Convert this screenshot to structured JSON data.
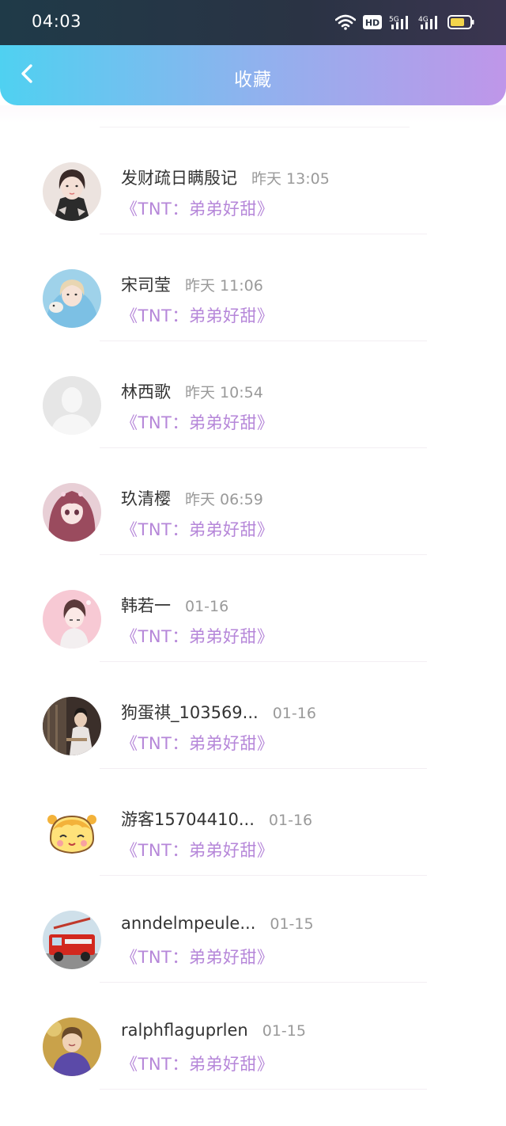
{
  "status_bar": {
    "time": "04:03",
    "icons": [
      "wifi-icon",
      "hd-icon",
      "signal-5g-icon",
      "signal-4g-icon",
      "battery-icon"
    ],
    "hd_label": "HD",
    "net1": "5G",
    "net2": "4G"
  },
  "nav": {
    "title": "收藏",
    "back_icon": "chevron-left-icon"
  },
  "colors": {
    "nav_gradient_start": "#4fd1f1",
    "nav_gradient_end": "#bf96e9",
    "book_title": "#b687d9",
    "name_text": "#333333",
    "time_text": "#9a9a9a"
  },
  "items": [
    {
      "name": "发财疏日瞒殷记",
      "time": "昨天 13:05",
      "book": "《TNT：弟弟好甜》"
    },
    {
      "name": "宋司莹",
      "time": "昨天 11:06",
      "book": "《TNT：弟弟好甜》"
    },
    {
      "name": "林西歌",
      "time": "昨天 10:54",
      "book": "《TNT：弟弟好甜》"
    },
    {
      "name": "玖清樱",
      "time": "昨天 06:59",
      "book": "《TNT：弟弟好甜》"
    },
    {
      "name": "韩若一",
      "time": "01-16",
      "book": "《TNT：弟弟好甜》"
    },
    {
      "name": "狗蛋祺_103569...",
      "time": "01-16",
      "book": "《TNT：弟弟好甜》"
    },
    {
      "name": "游客15704410...",
      "time": "01-16",
      "book": "《TNT：弟弟好甜》"
    },
    {
      "name": "anndelmpeule...",
      "time": "01-15",
      "book": "《TNT：弟弟好甜》"
    },
    {
      "name": "ralphflaguprlen",
      "time": "01-15",
      "book": "《TNT：弟弟好甜》"
    }
  ]
}
